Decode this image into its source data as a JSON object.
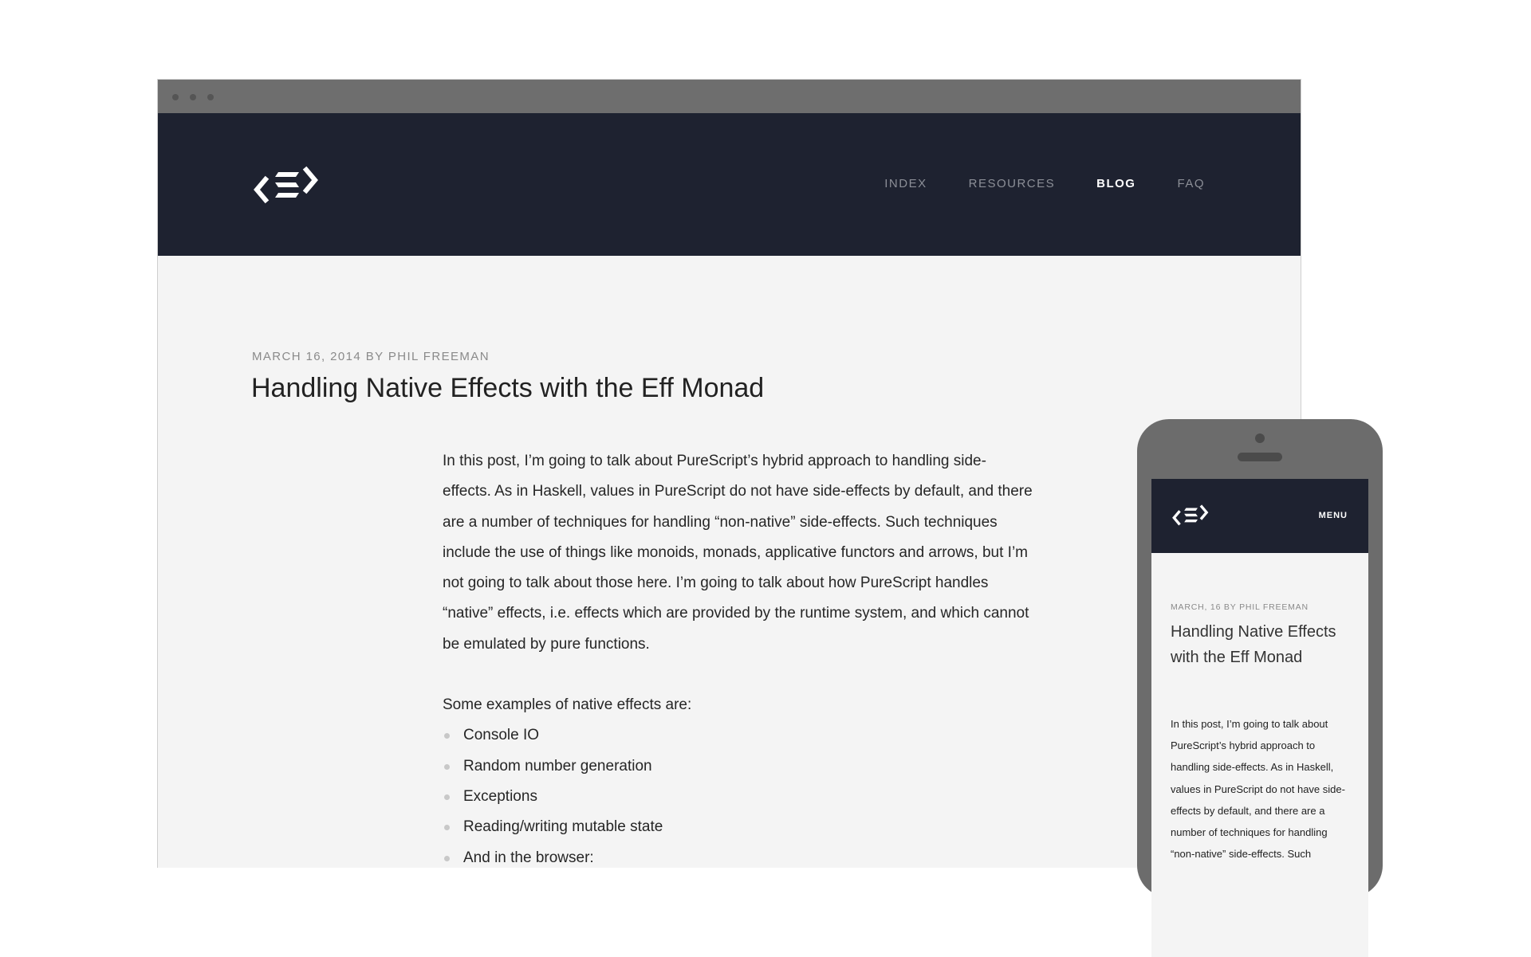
{
  "desktop": {
    "nav": [
      "INDEX",
      "RESOURCES",
      "BLOG",
      "FAQ"
    ],
    "active_nav": "BLOG",
    "post": {
      "meta": "MARCH 16, 2014 BY PHIL FREEMAN",
      "title": "Handling Native Effects with the Eff Monad",
      "intro": "In this post, I’m going to talk about PureScript’s hybrid approach to handling side-effects. As in Haskell, values in PureScript do not have side-effects by default, and there are a number of techniques for handling “non-native” side-effects. Such techniques include the use of things like monoids, monads, applicative functors and arrows, but I’m not going to talk about those here. I’m going to talk about how PureScript handles “native” effects, i.e. effects which are provided by the runtime system, and which cannot be emulated by pure functions.",
      "examples_heading": "Some examples of native effects are:",
      "examples": [
        "Console IO",
        "Random number generation",
        "Exceptions",
        "Reading/writing mutable state",
        "And in the browser:"
      ]
    }
  },
  "mobile": {
    "menu_label": "MENU",
    "post": {
      "meta": "MARCH, 16 BY PHIL FREEMAN",
      "title": "Handling Native Effects with the Eff Monad",
      "intro": "In this post, I’m going to talk about PureScript’s hybrid approach to handling side-effects. As in Haskell, values in PureScript do not have side-effects by default, and there are a number of techniques for handling “non-native” side-effects. Such"
    }
  },
  "colors": {
    "header_bg": "#1e2230",
    "chrome_bg": "#6e6e6e",
    "page_bg": "#f4f4f4",
    "nav_inactive": "#8c8f97",
    "nav_active": "#ffffff"
  },
  "icons": {
    "logo": "purescript-logo-icon",
    "chrome_dots": "window-dot-icon"
  }
}
